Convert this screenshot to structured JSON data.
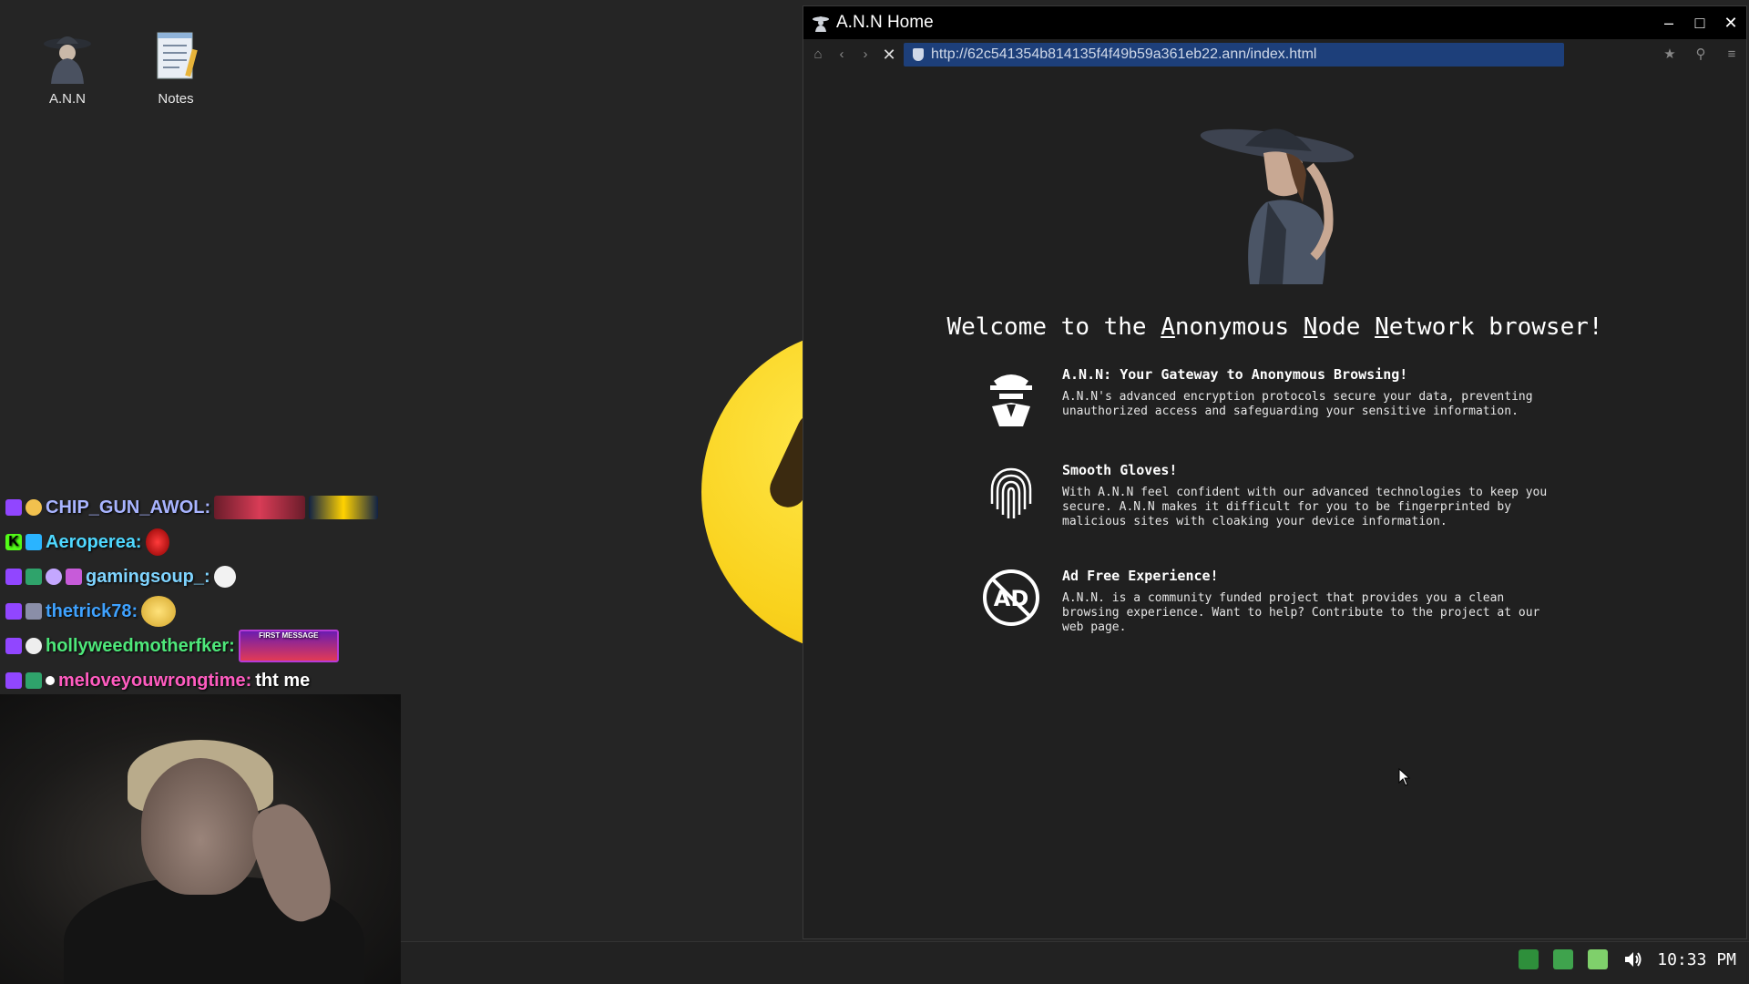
{
  "desktop": {
    "icons": [
      {
        "label": "A.N.N"
      },
      {
        "label": "Notes"
      }
    ]
  },
  "chat": {
    "lines": [
      {
        "user": "CHIP_GUN_AWOL:",
        "user_color": "#a8b4ff",
        "message": ""
      },
      {
        "user": "Aeroperea:",
        "user_color": "#4fd8ff",
        "message": ""
      },
      {
        "user": "gamingsoup_:",
        "user_color": "#7fd4ff",
        "message": ""
      },
      {
        "user": "thetrick78:",
        "user_color": "#3fa2ff",
        "message": ""
      },
      {
        "user": "hollyweedmotherfker:",
        "user_color": "#4ee87a",
        "message": ""
      },
      {
        "user": "meloveyouwrongtime:",
        "user_color": "#ff5cc0",
        "message": "tht me"
      }
    ],
    "emote_first_message": "FIRST MESSAGE"
  },
  "browser": {
    "title": "A.N.N Home",
    "url": "http://62c541354b814135f4f49b59a361eb22.ann/index.html",
    "controls": {
      "minimize": "–",
      "maximize": "□",
      "close": "✕"
    },
    "nav": {
      "home": "⌂",
      "back": "‹",
      "forward": "›",
      "stop": "✕",
      "bookmark": "★",
      "search": "⚲",
      "menu": "≡"
    }
  },
  "page": {
    "welcome_pre": "Welcome to the ",
    "welcome_a": "A",
    "welcome_nonymous": "nonymous ",
    "welcome_n1": "N",
    "welcome_ode": "ode ",
    "welcome_n2": "N",
    "welcome_etwork": "etwork browser!",
    "features": [
      {
        "title": "A.N.N: Your Gateway to Anonymous Browsing!",
        "desc": "A.N.N's advanced encryption protocols secure your data, preventing\nunauthorized access and safeguarding your sensitive information."
      },
      {
        "title": "Smooth Gloves!",
        "desc": "With A.N.N feel confident with our advanced technologies to keep you\nsecure. A.N.N makes it difficult for you to be fingerprinted by\nmalicious sites with cloaking your device information."
      },
      {
        "title": "Ad Free Experience!",
        "desc": "A.N.N. is a community funded project that provides you a clean\nbrowsing experience. Want to help? Contribute to the project at our\nweb page."
      }
    ],
    "ad_icon_text": "AD"
  },
  "taskbar": {
    "clock": "10:33 PM"
  }
}
